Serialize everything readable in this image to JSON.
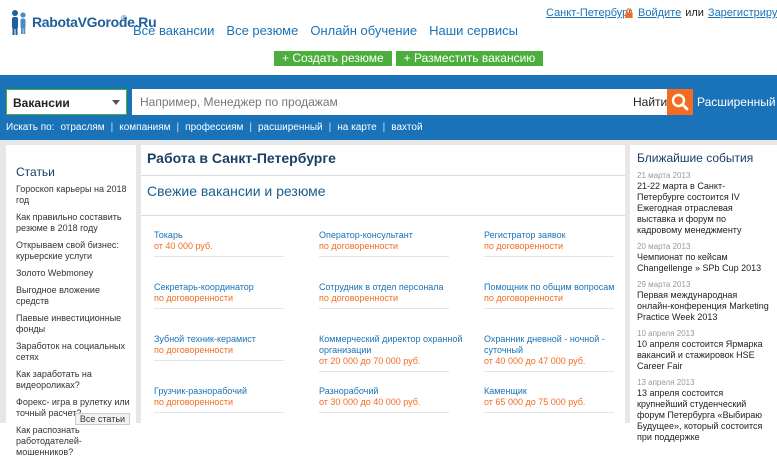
{
  "header": {
    "logo_text": "RabotaVGorode.Ru",
    "logo_reg": "®",
    "nav": [
      "Все вакансии",
      "Все резюме",
      "Онлайн обучение",
      "Наши сервисы"
    ],
    "city": "Санкт-Петербург",
    "login": "Войдите",
    "or": "или",
    "register": "Зарегистрируйтесь.",
    "create_resume": "+ Создать резюме",
    "post_vacancy": "+ Разместить вакансию"
  },
  "search": {
    "category": "Вакансии",
    "placeholder": "Например, Менеджер по продажам",
    "find_label": "Найти",
    "advanced": "Расширенный",
    "search_by_label": "Искать по:",
    "search_by": [
      "отраслям",
      "компаниям",
      "профессиям",
      "расширенный",
      "на карте",
      "вахтой"
    ]
  },
  "articles": {
    "title": "Статьи",
    "items": [
      "Гороскоп карьеры на 2018 год",
      "Как правильно составить резюме в 2018 году",
      "Открываем свой бизнес: курьерские услуги",
      "Золото Webmoney",
      "Выгодное вложение средств",
      "Паевые инвестиционные фонды",
      "Заработок на социальных сетях",
      "Как заработать на видеороликах?",
      "Форекс- игра в рулетку или точный расчет?",
      "Как распознать работодателей-мошенников?"
    ],
    "all_button": "Все статьи"
  },
  "center": {
    "title": "Работа в Санкт-Петербурге",
    "subtitle": "Свежие вакансии и резюме",
    "jobs": [
      {
        "title": "Токарь",
        "salary": "от 40 000 руб."
      },
      {
        "title": "Оператор-консультант",
        "salary": "по договоренности"
      },
      {
        "title": "Регистратор заявок",
        "salary": "по договоренности"
      },
      {
        "title": "Секретарь-координатор",
        "salary": "по договоренности"
      },
      {
        "title": "Сотрудник в отдел персонала",
        "salary": "по договоренности"
      },
      {
        "title": "Помощник по общим вопросам",
        "salary": "по договоренности"
      },
      {
        "title": "Зубной техник-керамист",
        "salary": "по договоренности"
      },
      {
        "title": "Коммерческий директор охранной организации",
        "salary": "от 20 000 до 70 000 руб."
      },
      {
        "title": "Охранник дневной - ночной - суточный",
        "salary": "от 40 000 до 47 000 руб."
      },
      {
        "title": "Грузчик-разнорабочий",
        "salary": "по договоренности"
      },
      {
        "title": "Разнорабочий",
        "salary": "от 30 000 до 40 000 руб."
      },
      {
        "title": "Каменщик",
        "salary": "от 65 000 до 75 000 руб."
      }
    ]
  },
  "events": {
    "title": "Ближайшие события",
    "items": [
      {
        "date": "21 марта 2013",
        "text": "21-22 марта в Санкт-Петербурге состоится IV Ежегодная отраслевая выставка и форум по кадровому менеджменту"
      },
      {
        "date": "20 марта 2013",
        "text": "Чемпионат по кейсам Changellenge » SPb Cup 2013"
      },
      {
        "date": "29 марта 2013",
        "text": "Первая международная онлайн-конференция Marketing Practice Week 2013"
      },
      {
        "date": "10 апреля 2013",
        "text": "10 апреля состоится Ярмарка вакансий и стажировок HSE Career Fair"
      },
      {
        "date": "13 апреля 2013",
        "text": "13 апреля состоится крупнейший студенческий форум Петербурга «Выбираю Будущее», который состоится при поддержке"
      }
    ]
  },
  "colors": {
    "brand_blue": "#1a73b8",
    "accent_orange": "#f26d21",
    "action_green": "#4cae3c"
  }
}
